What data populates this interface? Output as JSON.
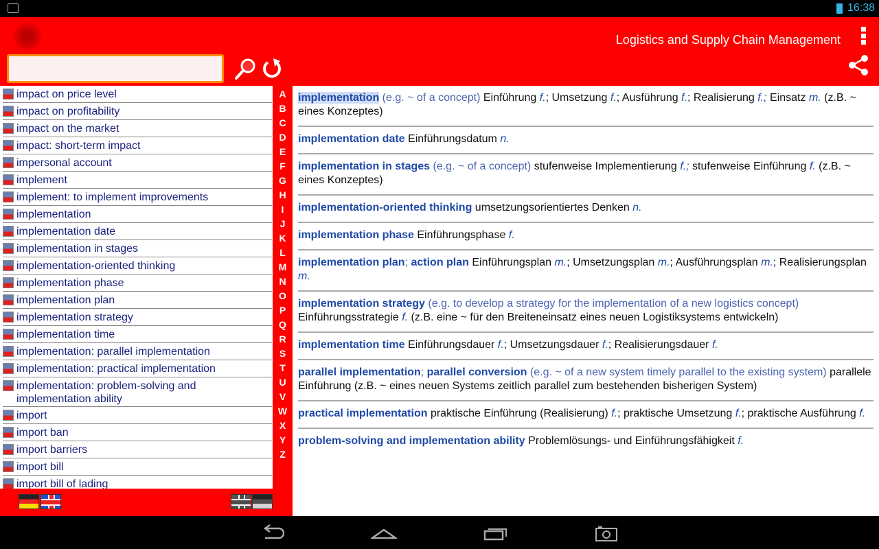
{
  "status": {
    "time": "16:38"
  },
  "header": {
    "title": "Logistics and Supply Chain Management"
  },
  "search": {
    "value": "",
    "placeholder": ""
  },
  "list": [
    "impact on price level",
    "impact on profitability",
    "impact on the market",
    "impact: short-term impact",
    "impersonal account",
    "implement",
    "implement: to implement improvements",
    "implementation",
    "implementation date",
    "implementation in stages",
    "implementation-oriented thinking",
    "implementation phase",
    "implementation plan",
    "implementation strategy",
    "implementation time",
    "implementation: parallel implementation",
    "implementation: practical implementation",
    "implementation: problem-solving and implementation ability",
    "import",
    "import ban",
    "import barriers",
    "import bill",
    "import bill of lading"
  ],
  "alphabet": [
    "A",
    "B",
    "C",
    "D",
    "E",
    "F",
    "G",
    "H",
    "I",
    "J",
    "K",
    "L",
    "M",
    "N",
    "O",
    "P",
    "Q",
    "R",
    "S",
    "T",
    "U",
    "V",
    "W",
    "X",
    "Y",
    "Z"
  ],
  "direction": {
    "de_en": "German to English",
    "en_de": "English to German"
  },
  "entries": [
    [
      [
        "hl",
        "implementation"
      ],
      [
        "n",
        " (e.g. ~ of a concept)"
      ],
      [
        "g",
        " Einführung "
      ],
      [
        "i",
        "f."
      ],
      [
        "g",
        "; Umsetzung "
      ],
      [
        "i",
        "f."
      ],
      [
        "g",
        "; Ausführung "
      ],
      [
        "i",
        "f."
      ],
      [
        "g",
        "; Realisierung "
      ],
      [
        "i",
        "f.;"
      ],
      [
        "g",
        " Einsatz "
      ],
      [
        "i",
        "m."
      ],
      [
        "g",
        " (z.B. ~ eines Konzeptes)"
      ]
    ],
    [
      [
        "h",
        "implementation date"
      ],
      [
        "g",
        " Einführungsdatum "
      ],
      [
        "i",
        "n."
      ]
    ],
    [
      [
        "h",
        "implementation in stages"
      ],
      [
        "n",
        " (e.g. ~ of a concept)"
      ],
      [
        "g",
        " stufenweise Implementierung "
      ],
      [
        "i",
        "f.;"
      ],
      [
        "g",
        " stufenweise Einführung "
      ],
      [
        "i",
        "f."
      ],
      [
        "g",
        " (z.B. ~ eines Konzeptes)"
      ]
    ],
    [
      [
        "h",
        "implementation-oriented thinking"
      ],
      [
        "g",
        " umsetzungsorientiertes Denken "
      ],
      [
        "i",
        "n."
      ]
    ],
    [
      [
        "h",
        "implementation phase"
      ],
      [
        "g",
        " Einführungsphase "
      ],
      [
        "i",
        "f."
      ]
    ],
    [
      [
        "h",
        "implementation plan"
      ],
      [
        "n",
        "; "
      ],
      [
        "h",
        "action plan"
      ],
      [
        "g",
        " Einführungsplan "
      ],
      [
        "i",
        "m."
      ],
      [
        "g",
        "; Umsetzungsplan "
      ],
      [
        "i",
        "m."
      ],
      [
        "g",
        "; Ausführungsplan "
      ],
      [
        "i",
        "m."
      ],
      [
        "g",
        "; Realisierungsplan "
      ],
      [
        "i",
        "m."
      ]
    ],
    [
      [
        "h",
        "implementation strategy"
      ],
      [
        "n",
        " (e.g. to develop a strategy for the implementation of a new logistics concept)"
      ],
      [
        "g",
        " Einführungsstrategie "
      ],
      [
        "i",
        "f."
      ],
      [
        "g",
        " (z.B. eine ~ für den Breiteneinsatz eines neuen Logistiksystems entwickeln)"
      ]
    ],
    [
      [
        "h",
        "implementation time"
      ],
      [
        "g",
        " Einführungsdauer "
      ],
      [
        "i",
        "f."
      ],
      [
        "g",
        "; Umsetzungsdauer "
      ],
      [
        "i",
        "f."
      ],
      [
        "g",
        "; Realisierungsdauer "
      ],
      [
        "i",
        "f."
      ]
    ],
    [
      [
        "h",
        "parallel implementation"
      ],
      [
        "n",
        "; "
      ],
      [
        "h",
        "parallel conversion"
      ],
      [
        "n",
        " (e.g. ~ of a new system timely parallel to the existing system)"
      ],
      [
        "g",
        " parallele Einführung (z.B. ~ eines neuen Systems zeitlich parallel zum bestehenden bisherigen System)"
      ]
    ],
    [
      [
        "h",
        "practical implementation"
      ],
      [
        "g",
        " praktische Einführung (Realisierung) "
      ],
      [
        "i",
        "f."
      ],
      [
        "g",
        "; praktische Umsetzung "
      ],
      [
        "i",
        "f."
      ],
      [
        "g",
        "; praktische Ausführung "
      ],
      [
        "i",
        "f."
      ]
    ],
    [
      [
        "h",
        "problem-solving and implementation ability"
      ],
      [
        "g",
        " Problemlösungs- und Einführungsfähigkeit "
      ],
      [
        "i",
        "f."
      ]
    ]
  ],
  "colors": {
    "header": "#ff0000",
    "search_border": "#ff8c00",
    "headword": "#1e4aa8",
    "list_text": "#1a237e"
  }
}
